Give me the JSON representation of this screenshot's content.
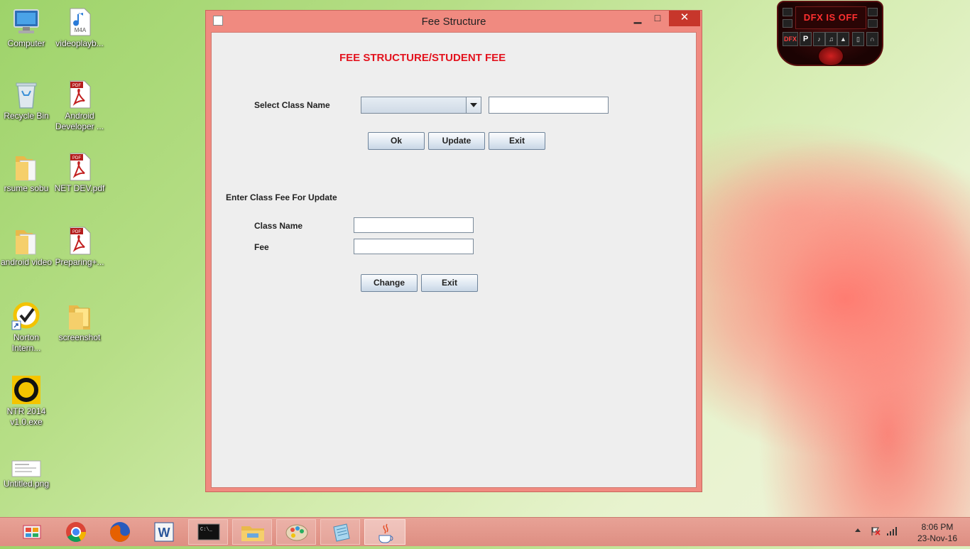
{
  "desktop": {
    "icons": [
      {
        "label": "Computer"
      },
      {
        "label": "videoplayb..."
      },
      {
        "label": "Recycle Bin"
      },
      {
        "label": "Android Developer ..."
      },
      {
        "label": "rsume sobu"
      },
      {
        "label": "NET DEV.pdf"
      },
      {
        "label": "android video"
      },
      {
        "label": "Preparing+..."
      },
      {
        "label": "Norton Intern..."
      },
      {
        "label": "screenshot"
      },
      {
        "label": "NTR 2014 v1.0.exe"
      },
      {
        "label": "Untitled.png"
      }
    ],
    "m4a_badge": "M4A",
    "pdf_badge": "PDF"
  },
  "window": {
    "title": "Fee Structure",
    "minimize": "▁",
    "maximize": "□",
    "close": "✕",
    "heading": "FEE STRUCTURE/STUDENT FEE",
    "select_class_label": "Select Class Name",
    "class_combo_value": "",
    "class_text_value": "",
    "buttons_top": {
      "ok": "Ok",
      "update": "Update",
      "exit": "Exit"
    },
    "update_section_label": "Enter Class Fee For Update",
    "class_name_label": "Class Name",
    "class_name_value": "",
    "fee_label": "Fee",
    "fee_value": "",
    "buttons_bottom": {
      "change": "Change",
      "exit": "Exit"
    }
  },
  "dfx": {
    "status": "DFX IS OFF",
    "logo": "DFX",
    "preset": "P"
  },
  "taskbar": {
    "cmd_text": "C:\\_",
    "word_letter": "W",
    "time": "8:06 PM",
    "date": "23-Nov-16"
  }
}
